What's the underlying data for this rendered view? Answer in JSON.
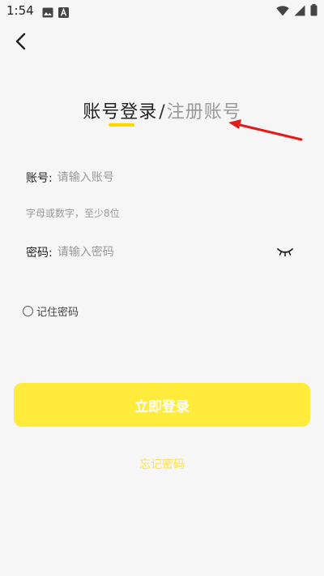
{
  "status_bar": {
    "time": "1:54",
    "icons": [
      "image-icon",
      "a-badge-icon",
      "wifi-icon",
      "signal-icon",
      "battery-icon"
    ]
  },
  "nav": {
    "back_icon": "chevron-left-icon"
  },
  "tabs": {
    "active": "账号登录",
    "separator": "/",
    "inactive": "注册账号"
  },
  "form": {
    "account": {
      "label": "账号:",
      "placeholder": "请输入账号",
      "value": ""
    },
    "account_hint": "字母或数字，至少8位",
    "password": {
      "label": "密码:",
      "placeholder": "请输入密码",
      "value": ""
    },
    "eye_icon": "eye-closed-icon"
  },
  "remember": {
    "label": "记住密码",
    "checked": false
  },
  "actions": {
    "login": "立即登录",
    "forgot": "忘记密码"
  },
  "colors": {
    "accent": "#ffeb3b",
    "underline": "#ffd600",
    "annotation": "#e31b1b"
  }
}
